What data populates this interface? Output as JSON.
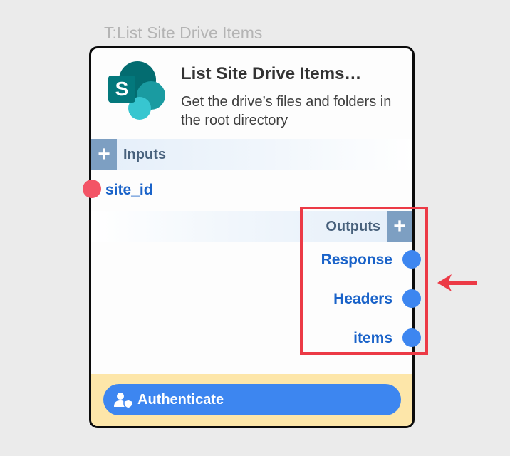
{
  "node": {
    "caption": "T:List Site Drive Items",
    "title": "List Site Drive Items…",
    "subtitle": "Get the drive’s files and folders in the root directory",
    "logo_icon": "sharepoint-logo"
  },
  "inputs": {
    "label": "Inputs",
    "add_symbol": "+",
    "ports": [
      {
        "label": "site_id",
        "status_color": "#f35466"
      }
    ]
  },
  "outputs": {
    "label": "Outputs",
    "add_symbol": "+",
    "ports": [
      {
        "label": "Response"
      },
      {
        "label": "Headers"
      },
      {
        "label": "items"
      }
    ],
    "port_color": "#3d86f0"
  },
  "footer": {
    "auth_label": "Authenticate",
    "auth_icon": "user-shield-icon"
  },
  "annotation": {
    "highlight_color": "#ec3a46",
    "arrow_icon": "arrow-left-icon"
  }
}
